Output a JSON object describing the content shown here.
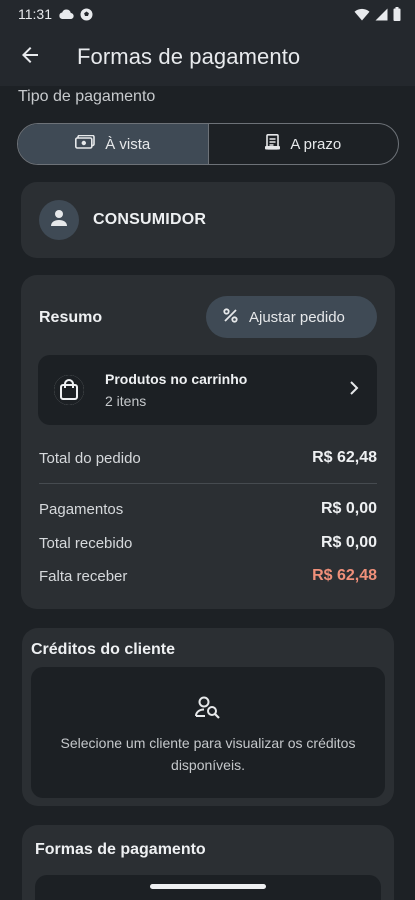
{
  "status_bar": {
    "time": "11:31",
    "icons": [
      "cloud-icon",
      "soccer-ball-icon",
      "wifi-icon",
      "signal-icon",
      "battery-icon"
    ]
  },
  "app_bar": {
    "title": "Formas de pagamento",
    "back_icon": "arrow-back-icon"
  },
  "payment_type": {
    "label": "Tipo de pagamento",
    "options": [
      {
        "label": "À vista",
        "icon": "cash-icon",
        "selected": true
      },
      {
        "label": "A prazo",
        "icon": "receipt-icon",
        "selected": false
      }
    ]
  },
  "customer": {
    "name": "CONSUMIDOR",
    "icon": "person-icon"
  },
  "summary": {
    "title": "Resumo",
    "adjust_label": "Ajustar pedido",
    "cart": {
      "title": "Produtos no carrinho",
      "subtitle": "2 itens"
    },
    "rows": [
      {
        "label": "Total do pedido",
        "value": "R$ 62,48"
      },
      {
        "label": "Pagamentos",
        "value": "R$ 0,00"
      },
      {
        "label": "Total recebido",
        "value": "R$ 0,00"
      },
      {
        "label": "Falta receber",
        "value": "R$ 62,48"
      }
    ]
  },
  "credits": {
    "title": "Créditos do cliente",
    "message": "Selecione um cliente para visualizar os créditos disponíveis."
  },
  "payment_methods": {
    "title": "Formas de pagamento"
  },
  "colors": {
    "background": "#1d2125",
    "card": "#2b2f33",
    "accent_selected": "#3f4a55",
    "due_amount": "#f0907a"
  }
}
